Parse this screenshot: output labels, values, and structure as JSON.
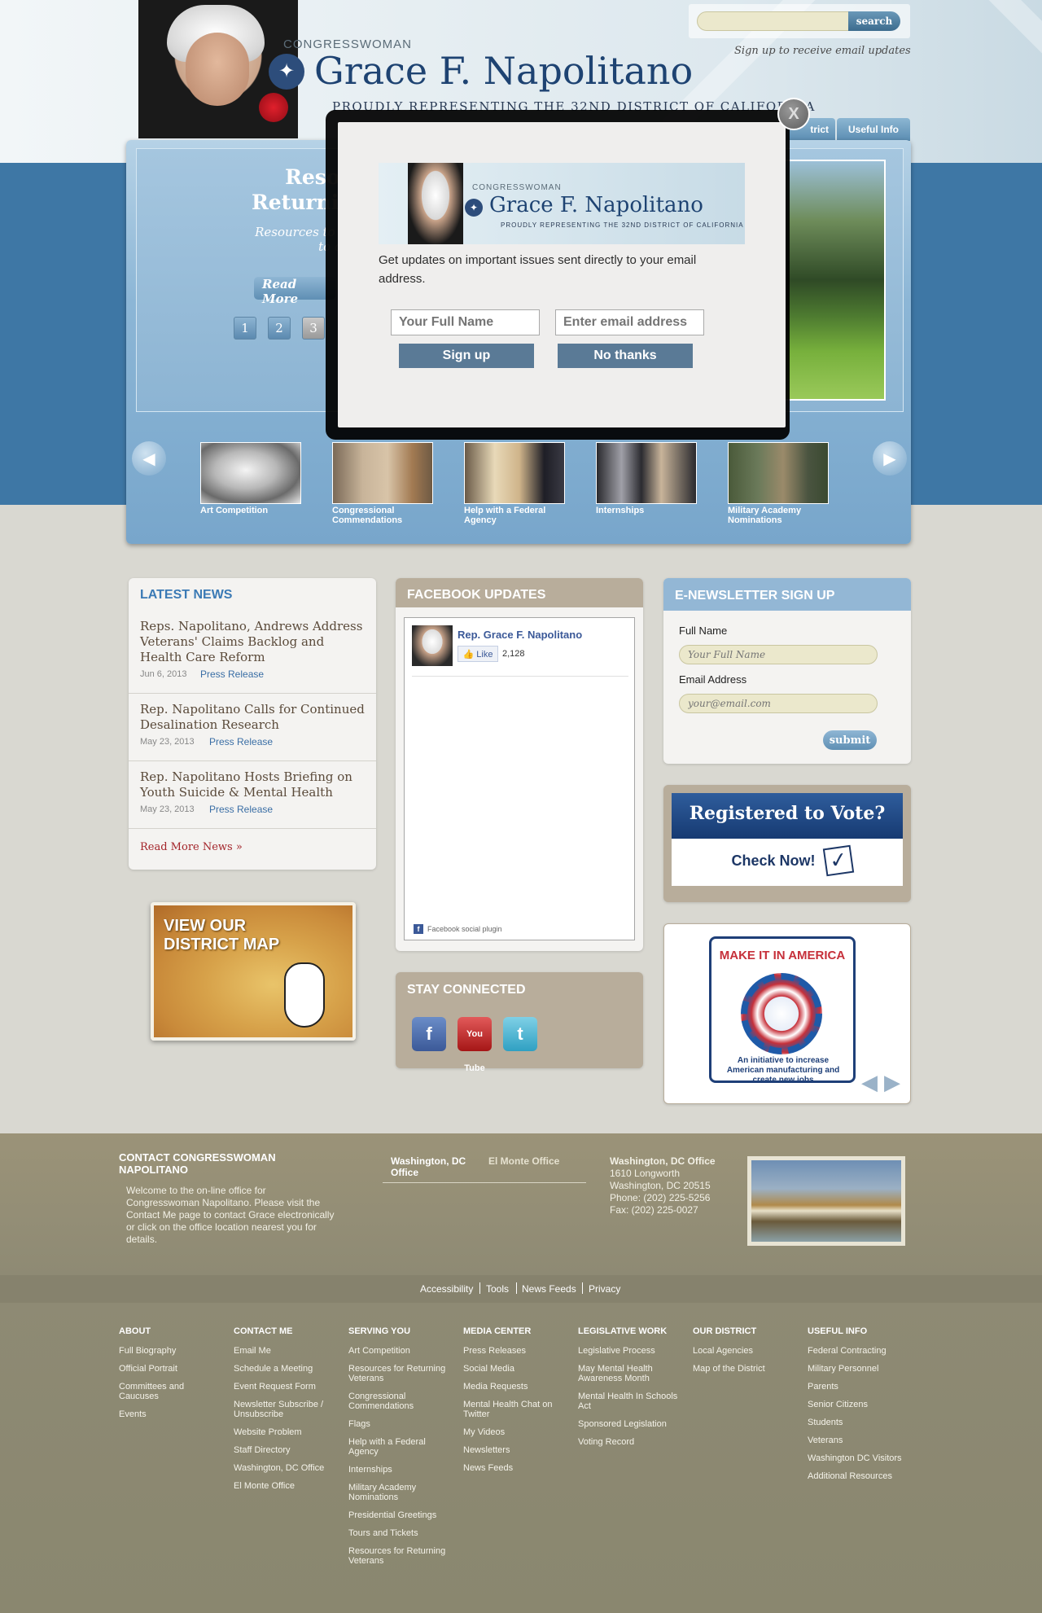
{
  "header": {
    "small_title": "CONGRESSWOMAN",
    "title": "Grace F. Napolitano",
    "subtitle": "PROUDLY REPRESENTING THE 32ND DISTRICT OF CALIFORNIA",
    "search_button": "search",
    "email_updates": "Sign up to receive email updates",
    "nav": [
      "trict",
      "Useful Info"
    ]
  },
  "hero": {
    "slide_title": "Resource\nReturning V",
    "slide_text": "Resources to help our\nto civilian li",
    "read_more": "Read More",
    "pages": [
      "1",
      "2",
      "3"
    ],
    "thumbnails": [
      "Art Competition",
      "Congressional Commendations",
      "Help with a Federal Agency",
      "Internships",
      "Military Academy Nominations"
    ]
  },
  "modal": {
    "close": "X",
    "banner_small": "CONGRESSWOMAN",
    "banner_title": "Grace F. Napolitano",
    "banner_subtitle": "PROUDLY REPRESENTING THE 32ND DISTRICT OF CALIFORNIA",
    "text": "Get updates on important issues sent directly to your email address.",
    "name_placeholder": "Your Full Name",
    "email_placeholder": "Enter email address",
    "signup": "Sign up",
    "no_thanks": "No thanks"
  },
  "news": {
    "heading": "LATEST NEWS",
    "items": [
      {
        "title": "Reps. Napolitano, Andrews Address Veterans' Claims Backlog and Health Care Reform",
        "date": "Jun 6, 2013",
        "type": "Press Release"
      },
      {
        "title": "Rep. Napolitano Calls for Continued Desalination Research",
        "date": "May 23, 2013",
        "type": "Press Release"
      },
      {
        "title": "Rep. Napolitano Hosts Briefing on Youth Suicide & Mental Health",
        "date": "May 23, 2013",
        "type": "Press Release"
      }
    ],
    "more": "Read More News »"
  },
  "district_map": {
    "label": "VIEW OUR\nDISTRICT MAP"
  },
  "facebook": {
    "heading": "FACEBOOK UPDATES",
    "name": "Rep. Grace F. Napolitano",
    "like": "Like",
    "like_count": "2,128",
    "plugin": "Facebook social plugin"
  },
  "stay_connected": {
    "heading": "STAY CONNECTED",
    "icons": [
      "facebook-icon",
      "youtube-icon",
      "twitter-icon"
    ],
    "youtube_text": "You Tube"
  },
  "enewsletter": {
    "heading": "E-NEWSLETTER SIGN UP",
    "name_label": "Full Name",
    "name_placeholder": "Your Full Name",
    "email_label": "Email Address",
    "email_placeholder": "your@email.com",
    "submit": "submit"
  },
  "vote": {
    "title": "Registered to Vote?",
    "check": "Check Now!"
  },
  "make_it": {
    "title": "MAKE IT IN AMERICA",
    "caption": "An initiative to increase American manufacturing and create new jobs"
  },
  "footer": {
    "contact_title": "CONTACT CONGRESSWOMAN NAPOLITANO",
    "contact_text": "Welcome to the on-line office for Congresswoman Napolitano. Please visit the Contact Me page to contact Grace electronically or click on the office location nearest you for details.",
    "office_tabs": [
      "Washington, DC Office",
      "El Monte Office"
    ],
    "office_details": [
      "Washington, DC Office",
      "1610 Longworth",
      "Washington, DC 20515",
      "Phone: (202) 225-5256",
      "Fax: (202) 225-0027"
    ],
    "utility_links": [
      "Accessibility",
      "Tools",
      "News Feeds",
      "Privacy"
    ],
    "columns": [
      {
        "title": "ABOUT",
        "items": [
          "Full Biography",
          "Official Portrait",
          "Committees and Caucuses",
          "Events"
        ]
      },
      {
        "title": "CONTACT ME",
        "items": [
          "Email Me",
          "Schedule a Meeting",
          "Event Request Form",
          "Newsletter Subscribe / Unsubscribe",
          "Website Problem",
          "Staff Directory",
          "Washington, DC Office",
          "El Monte Office"
        ]
      },
      {
        "title": "SERVING YOU",
        "items": [
          "Art Competition",
          "Resources for Returning Veterans",
          "Congressional Commendations",
          "Flags",
          "Help with a Federal Agency",
          "Internships",
          "Military Academy Nominations",
          "Presidential Greetings",
          "Tours and Tickets",
          "Resources for Returning Veterans"
        ]
      },
      {
        "title": "MEDIA CENTER",
        "items": [
          "Press Releases",
          "Social Media",
          "Media Requests",
          "Mental Health Chat on Twitter",
          "My Videos",
          "Newsletters",
          "News Feeds"
        ]
      },
      {
        "title": "LEGISLATIVE WORK",
        "items": [
          "Legislative Process",
          "May Mental Health Awareness Month",
          "Mental Health In Schools Act",
          "Sponsored Legislation",
          "Voting Record"
        ]
      },
      {
        "title": "OUR DISTRICT",
        "items": [
          "Local Agencies",
          "Map of the District"
        ]
      },
      {
        "title": "USEFUL INFO",
        "items": [
          "Federal Contracting",
          "Military Personnel",
          "Parents",
          "Senior Citizens",
          "Students",
          "Veterans",
          "Washington DC Visitors",
          "Additional Resources"
        ]
      }
    ]
  }
}
